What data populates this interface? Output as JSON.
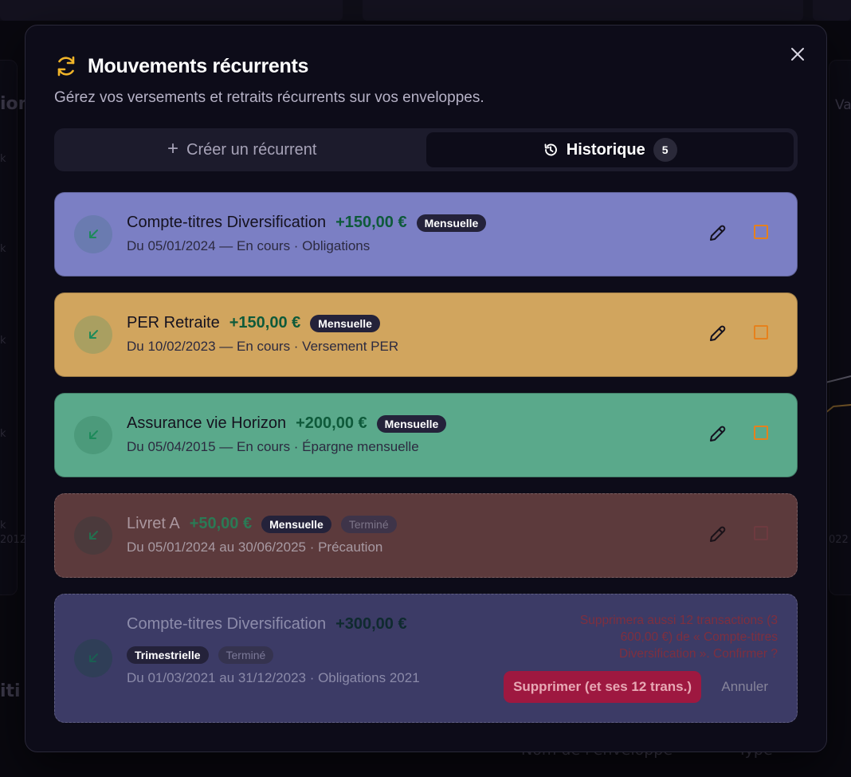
{
  "modal": {
    "title": "Mouvements récurrents",
    "subtitle": "Gérez vos versements et retraits récurrents sur vos enveloppes.",
    "title_icon": "refresh-icon",
    "close_icon": "close-icon"
  },
  "tabs": {
    "create_label": "Créer un récurrent",
    "history_label": "Historique",
    "history_count": "5"
  },
  "items": [
    {
      "account": "Compte-titres Diversification",
      "amount": "+150,00 €",
      "frequency": "Mensuelle",
      "details": "Du 05/01/2024 — En cours · Obligations",
      "color": "#7b7fc4"
    },
    {
      "account": "PER Retraite",
      "amount": "+150,00 €",
      "frequency": "Mensuelle",
      "details": "Du 10/02/2023 — En cours · Versement PER",
      "color": "#d1a55e"
    },
    {
      "account": "Assurance vie Horizon",
      "amount": "+200,00 €",
      "frequency": "Mensuelle",
      "details": "Du 05/04/2015 — En cours · Épargne mensuelle",
      "color": "#5aa98b"
    },
    {
      "account": "Livret A",
      "amount": "+50,00 €",
      "frequency": "Mensuelle",
      "status": "Terminé",
      "details": "Du 05/01/2024 au 30/06/2025 · Précaution",
      "color": "#5c3a3c"
    },
    {
      "account": "Compte-titres Diversification",
      "amount": "+300,00 €",
      "frequency": "Trimestrielle",
      "status": "Terminé",
      "details": "Du 01/03/2021 au 31/12/2023 · Obligations 2021",
      "color": "#3c3b66",
      "confirm": {
        "message": "Supprimera aussi 12 transactions (3 600,00 €) de « Compte-titres Diversification ». Confirmer ?",
        "confirm_label": "Supprimer (et ses 12 trans.)",
        "cancel_label": "Annuler"
      }
    }
  ],
  "colors": {
    "accent_icon": "#f0b429",
    "delete_outline": "#e6811c",
    "danger": "#9e1840"
  }
}
